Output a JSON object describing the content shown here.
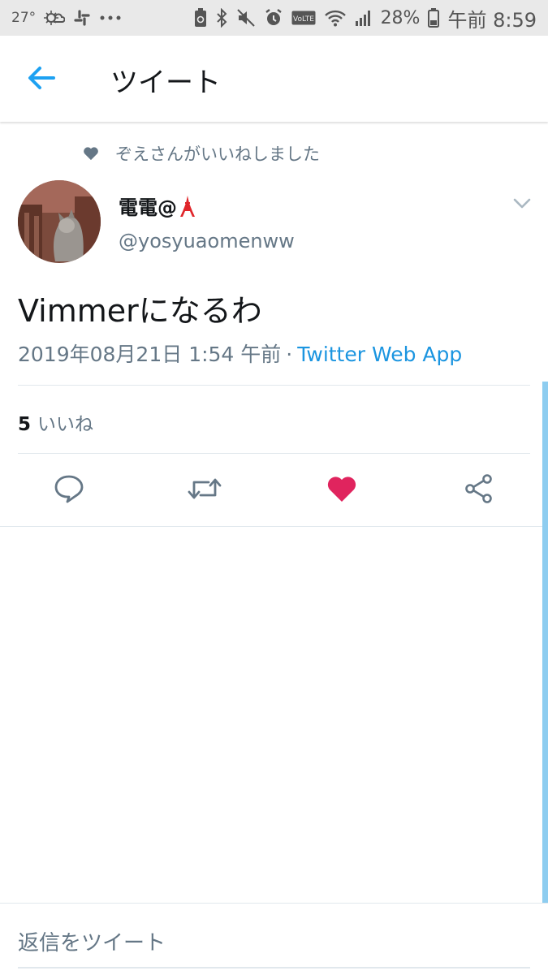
{
  "status_bar": {
    "temperature": "27°",
    "icons_left": [
      "weather-icon",
      "slack-icon",
      "more-dots-icon"
    ],
    "icons_right": [
      "recycle-icon",
      "bluetooth-icon",
      "mute-icon",
      "alarm-icon",
      "volte-icon",
      "wifi-icon",
      "signal-icon"
    ],
    "volte_label": "VoLTE",
    "battery_percent": "28%",
    "time": "午前 8:59"
  },
  "header": {
    "title": "ツイート",
    "back_icon": "arrow-left-icon",
    "accent_color": "#1da1f2"
  },
  "tweet": {
    "liked_by": "ぞえさんがいいねしました",
    "author_name": "電電@",
    "author_emoji_icon": "tokyo-tower-icon",
    "author_handle": "@yosyuaomenww",
    "text": "Vimmerになるわ",
    "timestamp": "2019年08月21日 1:54 午前",
    "separator": "·",
    "source_app": "Twitter Web App",
    "likes_count": "5",
    "likes_label": "いいね",
    "actions": [
      "reply-icon",
      "retweet-icon",
      "like-icon",
      "share-icon"
    ],
    "liked": true,
    "like_color": "#e0245e"
  },
  "reply": {
    "placeholder": "返信をツイート"
  }
}
